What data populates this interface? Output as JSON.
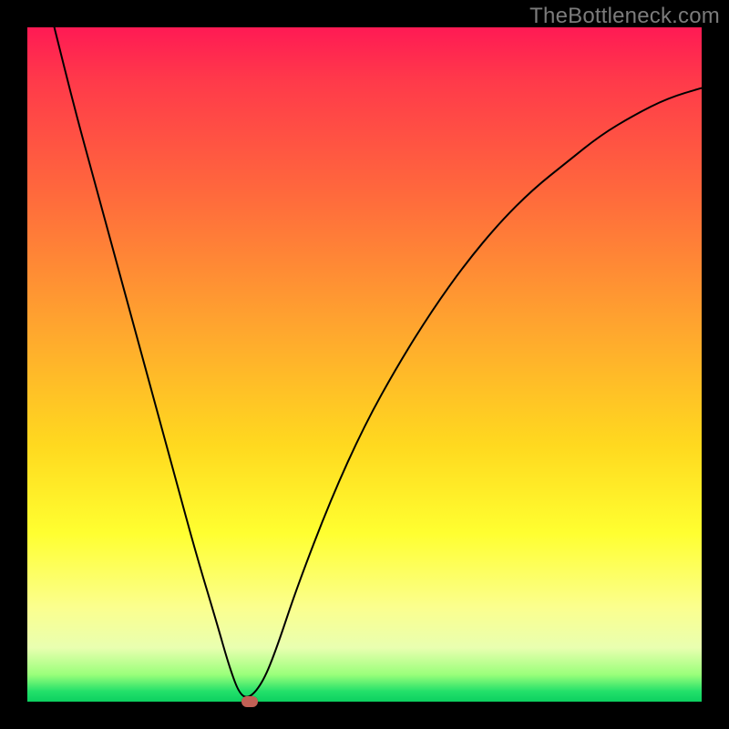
{
  "watermark": "TheBottleneck.com",
  "chart_data": {
    "type": "line",
    "title": "",
    "xlabel": "",
    "ylabel": "",
    "xlim": [
      0,
      100
    ],
    "ylim": [
      0,
      100
    ],
    "grid": false,
    "legend": false,
    "series": [
      {
        "name": "curve",
        "color": "#000000",
        "x": [
          4,
          7,
          10,
          13,
          16,
          19,
          22,
          25,
          28,
          30,
          31.5,
          33,
          35,
          37,
          40,
          45,
          50,
          55,
          60,
          65,
          70,
          75,
          80,
          85,
          90,
          95,
          100
        ],
        "y": [
          100,
          88,
          77,
          66,
          55,
          44,
          33,
          22,
          12,
          5,
          1,
          0.5,
          3,
          8,
          17,
          30,
          41,
          50,
          58,
          65,
          71,
          76,
          80,
          84,
          87,
          89.5,
          91
        ]
      }
    ],
    "marker": {
      "x": 33,
      "y": 0,
      "color": "#c16055"
    },
    "background_gradient": {
      "top": "#ff1a54",
      "mid": "#ffd91f",
      "bottom": "#0cd060"
    }
  }
}
